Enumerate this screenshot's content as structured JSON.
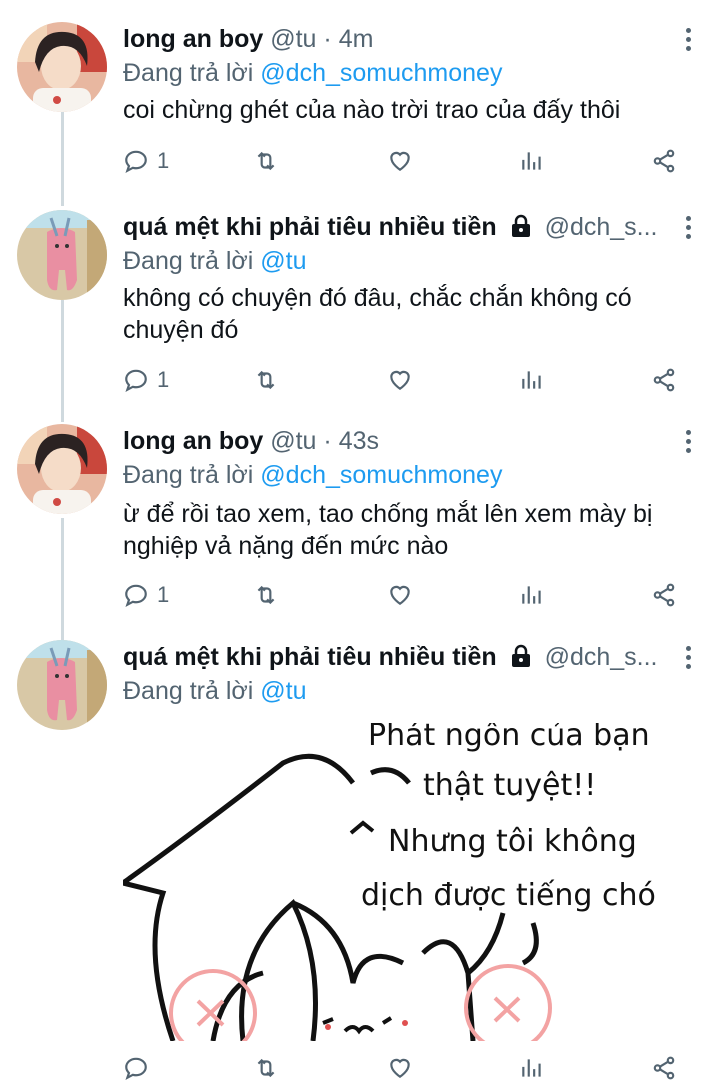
{
  "tweets": [
    {
      "name": "long an boy",
      "handle": "@tu",
      "dot": "·",
      "time": "4m",
      "reply_prefix": "Đang trả lời",
      "reply_to": "@dch_somuchmoney",
      "text": "coi chừng ghét của nào trời trao của đấy thôi",
      "replies": "1"
    },
    {
      "name": "quá mệt khi phải tiêu nhiều tiền",
      "handle": "@dch_s...",
      "reply_prefix": "Đang trả lời",
      "reply_to": "@tu",
      "text": "không có chuyện đó đâu, chắc chắn không có chuyện đó",
      "replies": "1"
    },
    {
      "name": "long an boy",
      "handle": "@tu",
      "dot": "·",
      "time": "43s",
      "reply_prefix": "Đang trả lời",
      "reply_to": "@dch_somuchmoney",
      "text": "ừ để rồi tao xem, tao chống mắt lên xem mày bị nghiệp vả nặng đến mức nào",
      "replies": "1"
    },
    {
      "name": "quá mệt khi phải tiêu nhiều tiền",
      "handle": "@dch_s...",
      "reply_prefix": "Đang trả lời",
      "reply_to": "@tu",
      "media_lines": [
        "Phát ngôn của bạn",
        "thật tuyệt!!",
        "Nhưng tôi không",
        "dịch được tiếng chó"
      ]
    }
  ],
  "icons": [
    "reply-icon",
    "retweet-icon",
    "like-icon",
    "views-icon",
    "share-icon",
    "lock-icon",
    "more-icon"
  ],
  "colors": {
    "link": "#1d9bf0",
    "muted": "#536471",
    "text": "#0f1419",
    "line": "#cfd9de"
  }
}
